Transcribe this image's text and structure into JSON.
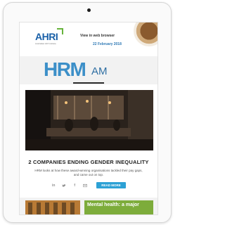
{
  "header": {
    "logo": "AHRI",
    "logo_tagline": "Australian HR Institute",
    "view_in_browser": "View in web browser",
    "date": "22 February 2018"
  },
  "masthead": {
    "brand_main": "HRM",
    "brand_suffix": "AM"
  },
  "article": {
    "headline": "2 COMPANIES ENDING GENDER INEQUALITY",
    "blurb": "HRM looks at how these award-winning organisations tackled their pay gaps, and came out on top.",
    "read_more": "READ MORE",
    "share_icons": [
      "linkedin-icon",
      "twitter-icon",
      "facebook-icon",
      "email-icon"
    ]
  },
  "next_article": {
    "title": "Mental health: a major"
  },
  "colors": {
    "accent": "#2da1d5",
    "brand_blue": "#3c8fc8",
    "green_tile": "#7dac3b"
  }
}
